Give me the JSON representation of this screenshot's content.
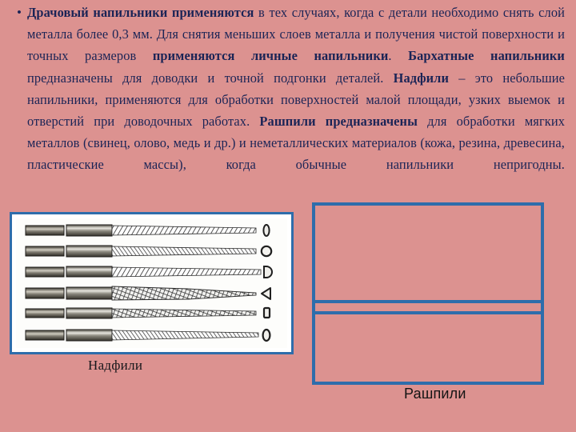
{
  "slide": {
    "background_color": "#dc9290",
    "text_color": "#1b2456",
    "accent_border_color": "#2e6dab",
    "bullet_glyph": "•"
  },
  "body_text": {
    "segments": [
      {
        "text": "Драчовый напильники применяются",
        "bold": true
      },
      {
        "text": " в тех случаях, когда с детали необходимо снять слой металла более 0,3 мм. Для снятия меньших слоев металла и получения чистой поверхности и точных размеров ",
        "bold": false
      },
      {
        "text": "применяются личные напильники",
        "bold": true
      },
      {
        "text": ". ",
        "bold": false
      },
      {
        "text": "Бархатные напильники",
        "bold": true
      },
      {
        "text": " предназначены для доводки и точной подгонки деталей. ",
        "bold": false
      },
      {
        "text": "Надфили",
        "bold": true
      },
      {
        "text": " – это небольшие напильники, применяются для обработки поверхностей малой площади, узких выемок и отверстий при доводочных работах. ",
        "bold": false
      },
      {
        "text": "Рашпили предназначены",
        "bold": true
      },
      {
        "text": " для обработки мягких металлов (свинец, олово, медь и др.) и неметаллических материалов (кожа, резина, древесина, пластические массы), когда обычные напильники непригодны.",
        "bold": false
      }
    ],
    "plain": "Драчовый напильники применяются в тех случаях, когда с детали необходимо снять слой металла более 0,3 мм. Для снятия меньших слоев металла и получения чистой поверхности и точных размеров применяются личные напильники. Бархатные напильники предназначены для доводки и точной подгонки деталей. Надфили – это небольшие напильники, применяются для обработки поверхностей малой площади, узких выемок и отверстий при доводочных работах. Рашпили предназначены для обработки мягких металлов (свинец, олово, медь и др.) и неметаллических материалов (кожа, резина, древесина, пластические массы), когда обычные напильники непригодны."
  },
  "figures": {
    "left": {
      "caption": "Надфили",
      "alt": "needle-files-illustration",
      "rows": [
        {
          "profile": "flat-rectangular",
          "teeth": "single-cut-fine"
        },
        {
          "profile": "round",
          "teeth": "spiral-cut"
        },
        {
          "profile": "half-round",
          "teeth": "single-cut"
        },
        {
          "profile": "triangular",
          "teeth": "double-cut-coarse"
        },
        {
          "profile": "square",
          "teeth": "double-cut"
        },
        {
          "profile": "oval",
          "teeth": "single-cut"
        }
      ]
    },
    "right": {
      "caption": "Рашпили",
      "alt": "rasps-image-placeholder",
      "panels": [
        "upper-placeholder",
        "lower-placeholder"
      ]
    }
  }
}
